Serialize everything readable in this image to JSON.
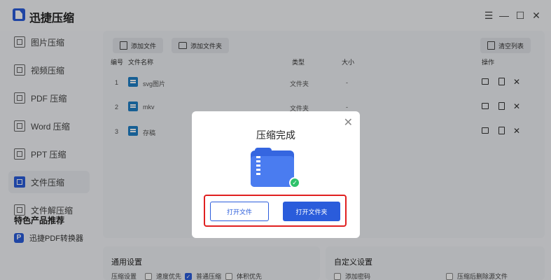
{
  "app": {
    "title": "迅捷压缩",
    "window_controls": [
      "menu-icon",
      "minimize-icon",
      "maximize-icon",
      "close-icon"
    ]
  },
  "sidebar": {
    "items": [
      {
        "label": "图片压缩",
        "icon": "image-compress-icon",
        "active": false
      },
      {
        "label": "视频压缩",
        "icon": "video-compress-icon",
        "active": false
      },
      {
        "label": "PDF 压缩",
        "icon": "pdf-compress-icon",
        "active": false
      },
      {
        "label": "Word 压缩",
        "icon": "word-compress-icon",
        "active": false
      },
      {
        "label": "PPT 压缩",
        "icon": "ppt-compress-icon",
        "active": false
      },
      {
        "label": "文件压缩",
        "icon": "file-compress-icon",
        "active": true
      },
      {
        "label": "文件解压缩",
        "icon": "file-decompress-icon",
        "active": false
      }
    ],
    "section_title": "特色产品推荐",
    "promo": {
      "label": "迅捷PDF转换器",
      "icon": "pdf-converter-icon"
    }
  },
  "toolbar": {
    "add_file": "添加文件",
    "add_folder": "添加文件夹",
    "clear_list": "清空列表"
  },
  "table": {
    "headers": {
      "index": "编号",
      "name": "文件名称",
      "type": "类型",
      "size": "大小",
      "ops": "操作"
    },
    "rows": [
      {
        "index": "1",
        "name": "svg图片",
        "type": "文件夹",
        "size": "-"
      },
      {
        "index": "2",
        "name": "mkv",
        "type": "文件夹",
        "size": "-"
      },
      {
        "index": "3",
        "name": "存稿",
        "type": "文件夹",
        "size": "-"
      }
    ]
  },
  "settings": {
    "general": {
      "title": "通用设置",
      "label": "压缩设置",
      "options": [
        {
          "label": "速度优先",
          "checked": false
        },
        {
          "label": "普通压缩",
          "checked": true
        },
        {
          "label": "体积优先",
          "checked": false
        }
      ]
    },
    "custom": {
      "title": "自定义设置",
      "options": [
        {
          "label": "添加密码",
          "checked": false
        },
        {
          "label": "压缩后删除源文件",
          "checked": false
        }
      ]
    }
  },
  "modal": {
    "title": "压缩完成",
    "open_file": "打开文件",
    "open_folder": "打开文件夹"
  },
  "colors": {
    "accent": "#2a5cdb",
    "highlight_border": "#e02020",
    "success": "#2ec26a",
    "file_icon": "#1f7fc6"
  }
}
